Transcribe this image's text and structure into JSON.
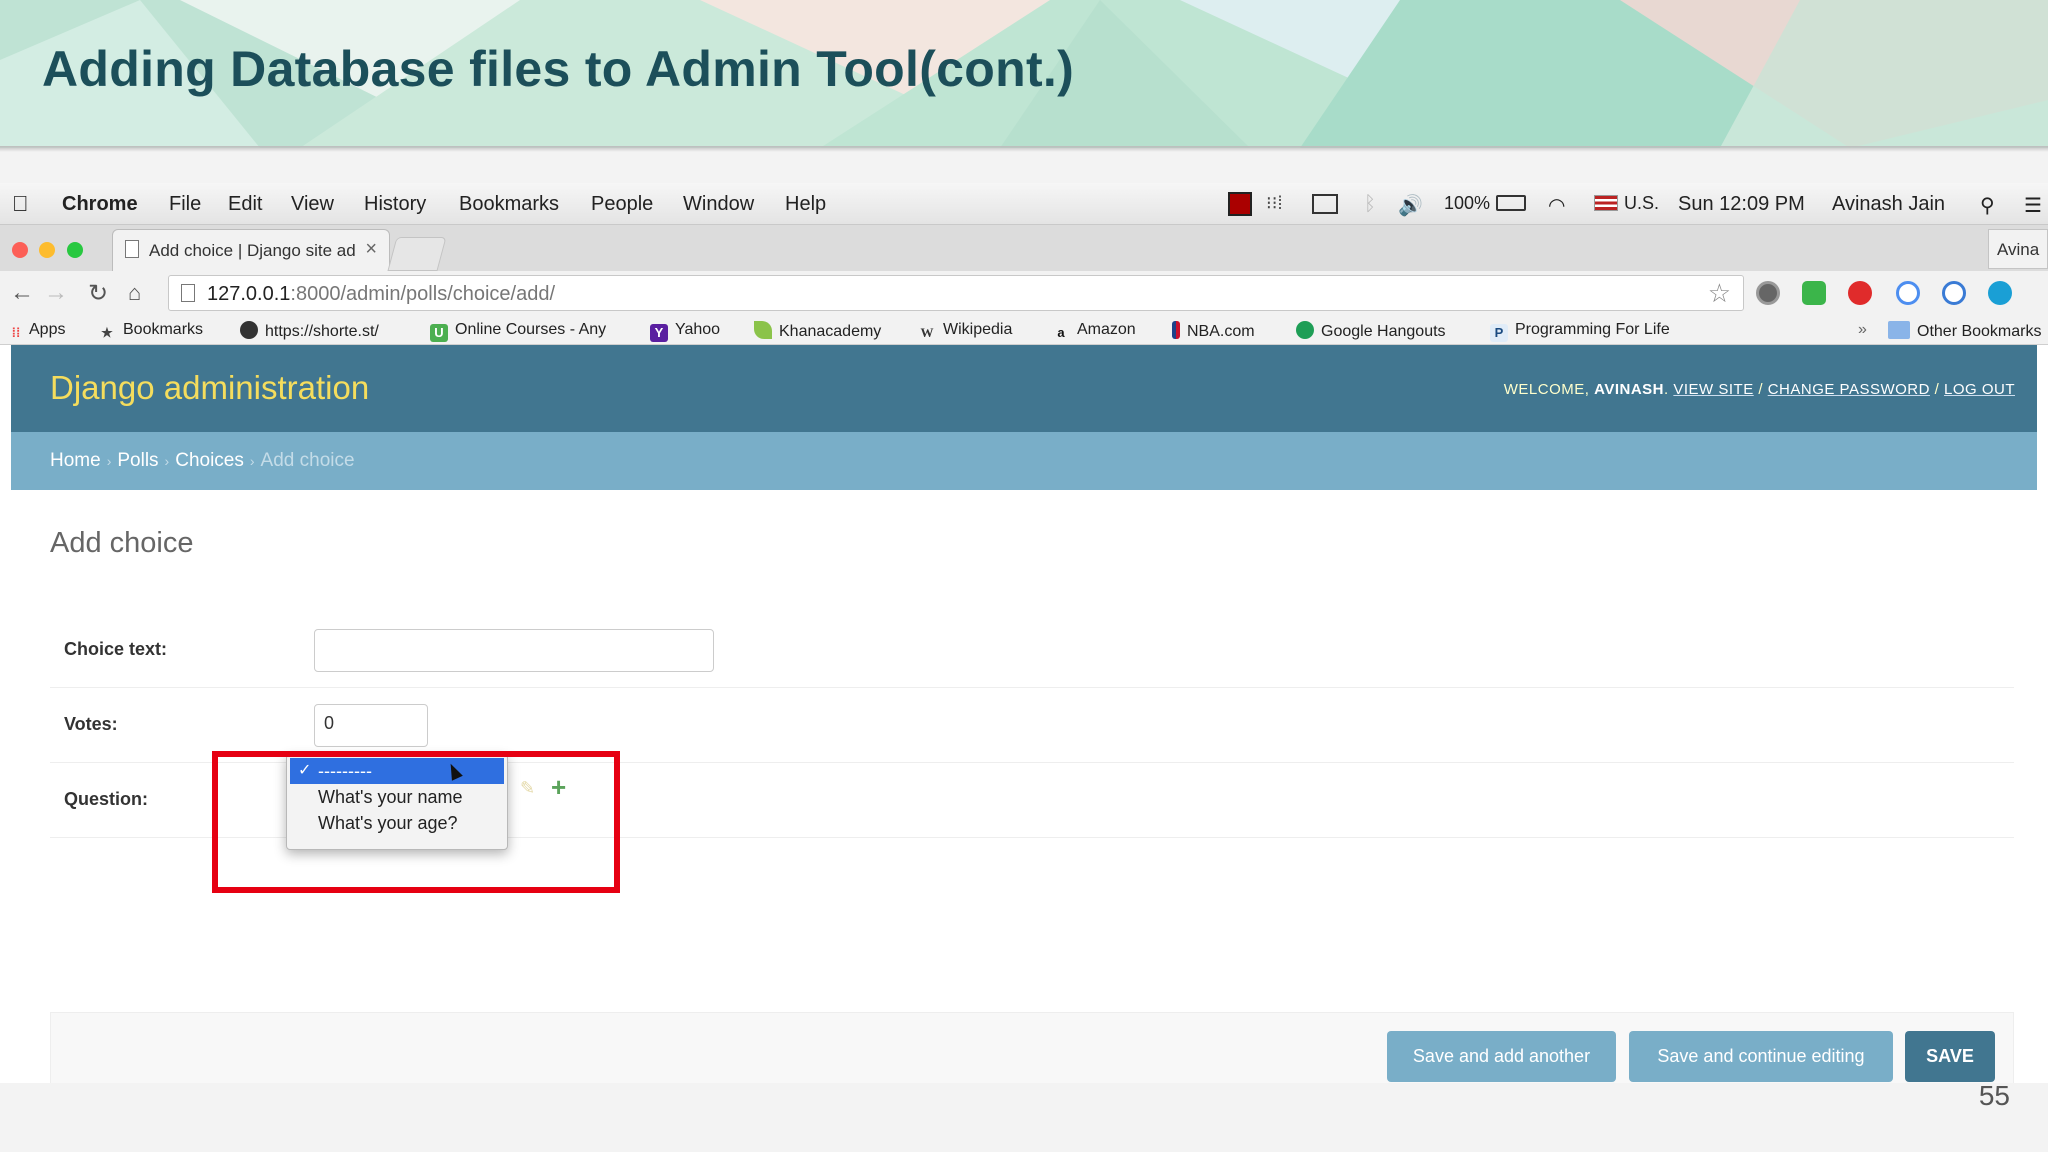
{
  "slide": {
    "title": "Adding Database files to Admin Tool(cont.)",
    "page_number": "55"
  },
  "menubar": {
    "app": "Chrome",
    "items": [
      "File",
      "Edit",
      "View",
      "History",
      "Bookmarks",
      "People",
      "Window",
      "Help"
    ],
    "battery": "100%",
    "input_source": "U.S.",
    "clock": "Sun 12:09 PM",
    "user": "Avinash Jain"
  },
  "browser": {
    "tab_title": "Add choice | Django site ad",
    "profile_label": "Avina",
    "url_host": "127.0.0.1",
    "url_path": ":8000/admin/polls/choice/add/",
    "bookmarks": [
      {
        "label": "Apps",
        "icon": "apps-icon"
      },
      {
        "label": "Bookmarks",
        "icon": "star-icon"
      },
      {
        "label": "https://shorte.st/",
        "icon": "shortest-icon"
      },
      {
        "label": "Online Courses - Any",
        "icon": "udemy-icon"
      },
      {
        "label": "Yahoo",
        "icon": "yahoo-icon"
      },
      {
        "label": "Khanacademy",
        "icon": "khan-icon"
      },
      {
        "label": "Wikipedia",
        "icon": "wikipedia-icon"
      },
      {
        "label": "Amazon",
        "icon": "amazon-icon"
      },
      {
        "label": "NBA.com",
        "icon": "nba-icon"
      },
      {
        "label": "Google Hangouts",
        "icon": "hangouts-icon"
      },
      {
        "label": "Programming For Life",
        "icon": "p-icon"
      }
    ],
    "overflow": "»",
    "other_bookmarks": "Other Bookmarks"
  },
  "django": {
    "brand": "Django administration",
    "welcome": "WELCOME,",
    "username": "AVINASH",
    "view_site": "VIEW SITE",
    "change_password": "CHANGE PASSWORD",
    "log_out": "LOG OUT",
    "sep": "/",
    "breadcrumbs": {
      "home": "Home",
      "polls": "Polls",
      "choices": "Choices",
      "current": "Add choice",
      "sep": "›"
    },
    "page_title": "Add choice",
    "fields": {
      "choice_text_label": "Choice text:",
      "choice_text_value": "",
      "votes_label": "Votes:",
      "votes_value": "0",
      "question_label": "Question:"
    },
    "question_options": [
      "---------",
      "What's your name",
      "What's your age?"
    ],
    "selected_option": "---------",
    "buttons": {
      "save_add_another": "Save and add another",
      "save_continue": "Save and continue editing",
      "save": "SAVE"
    }
  }
}
